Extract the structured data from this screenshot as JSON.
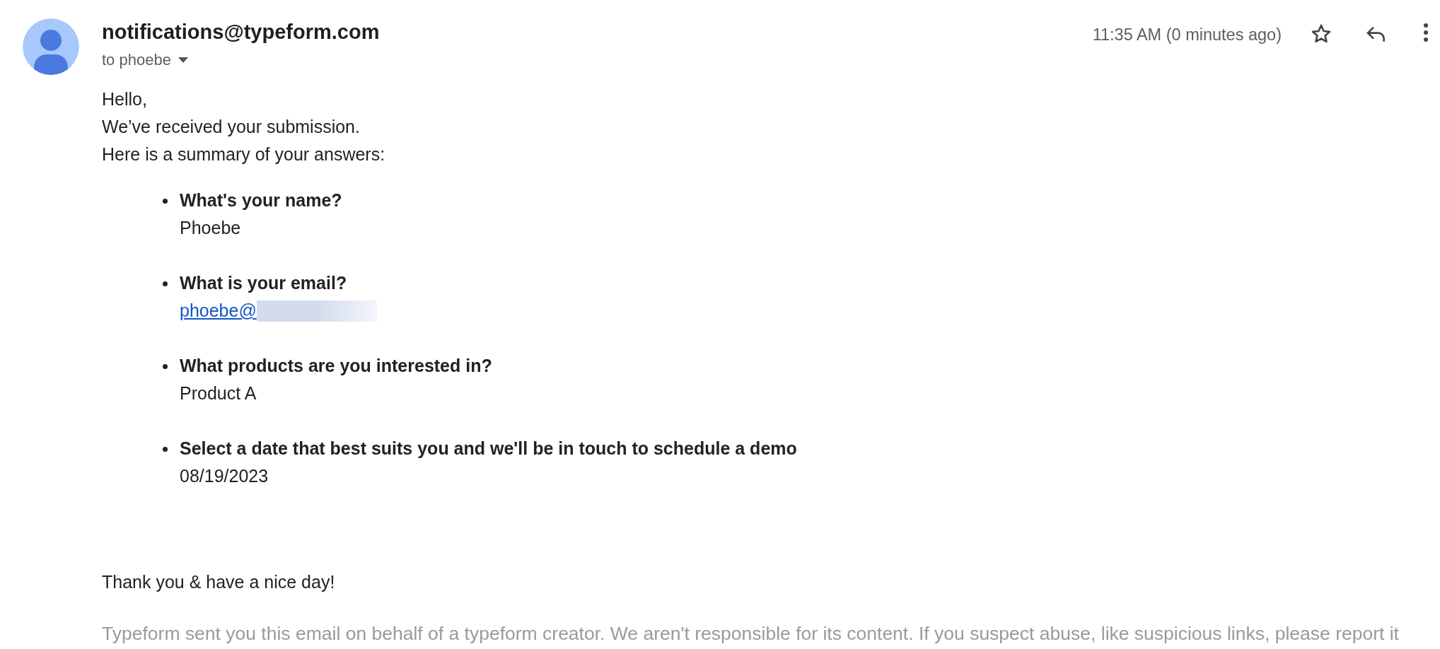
{
  "sender": "notifications@typeform.com",
  "recipient": "to phoebe",
  "time": "11:35 AM (0 minutes ago)",
  "intro": [
    "Hello,",
    "We’ve received your submission.",
    "Here is a summary of your answers:"
  ],
  "answers": [
    {
      "question": "What's your name?",
      "answer": "Phoebe",
      "kind": "text"
    },
    {
      "question": "What is your email?",
      "answer": "phoebe@",
      "kind": "link",
      "redacted": true
    },
    {
      "question": "What products are you interested in?",
      "answer": "Product A",
      "kind": "text"
    },
    {
      "question": "Select a date that best suits you and we'll be in touch to schedule a demo",
      "answer": "08/19/2023",
      "kind": "text"
    }
  ],
  "closing": "Thank you & have a nice day!",
  "footer": "Typeform sent you this email on behalf of a typeform creator. We aren't responsible for its content. If you suspect abuse, like suspicious links, please report it"
}
